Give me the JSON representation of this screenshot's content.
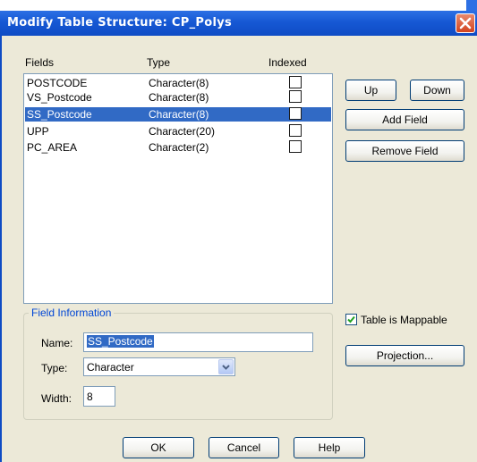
{
  "window": {
    "title": "Modify Table Structure: CP_Polys"
  },
  "list": {
    "headers": {
      "fields": "Fields",
      "type": "Type",
      "indexed": "Indexed"
    },
    "rows": [
      {
        "name": "POSTCODE",
        "type": "Character(8)",
        "indexed": false,
        "selected": false
      },
      {
        "name": "VS_Postcode",
        "type": "Character(8)",
        "indexed": false,
        "selected": false
      },
      {
        "name": "SS_Postcode",
        "type": "Character(8)",
        "indexed": false,
        "selected": true
      },
      {
        "name": "UPP",
        "type": "Character(20)",
        "indexed": false,
        "selected": false
      },
      {
        "name": "PC_AREA",
        "type": "Character(2)",
        "indexed": false,
        "selected": false
      }
    ]
  },
  "buttons": {
    "up": "Up",
    "down": "Down",
    "add_field": "Add Field",
    "remove_field": "Remove Field",
    "projection": "Projection...",
    "ok": "OK",
    "cancel": "Cancel",
    "help": "Help"
  },
  "field_info": {
    "title": "Field Information",
    "name_label": "Name:",
    "name_value": "SS_Postcode",
    "type_label": "Type:",
    "type_value": "Character",
    "width_label": "Width:",
    "width_value": "8"
  },
  "mappable": {
    "label": "Table is Mappable",
    "checked": true
  },
  "colors": {
    "titlebar": "#0f4cc4",
    "selection": "#316ac5",
    "dialog_bg": "#ece9d8",
    "groupbox_title": "#0046d5",
    "close": "#d2431f"
  }
}
